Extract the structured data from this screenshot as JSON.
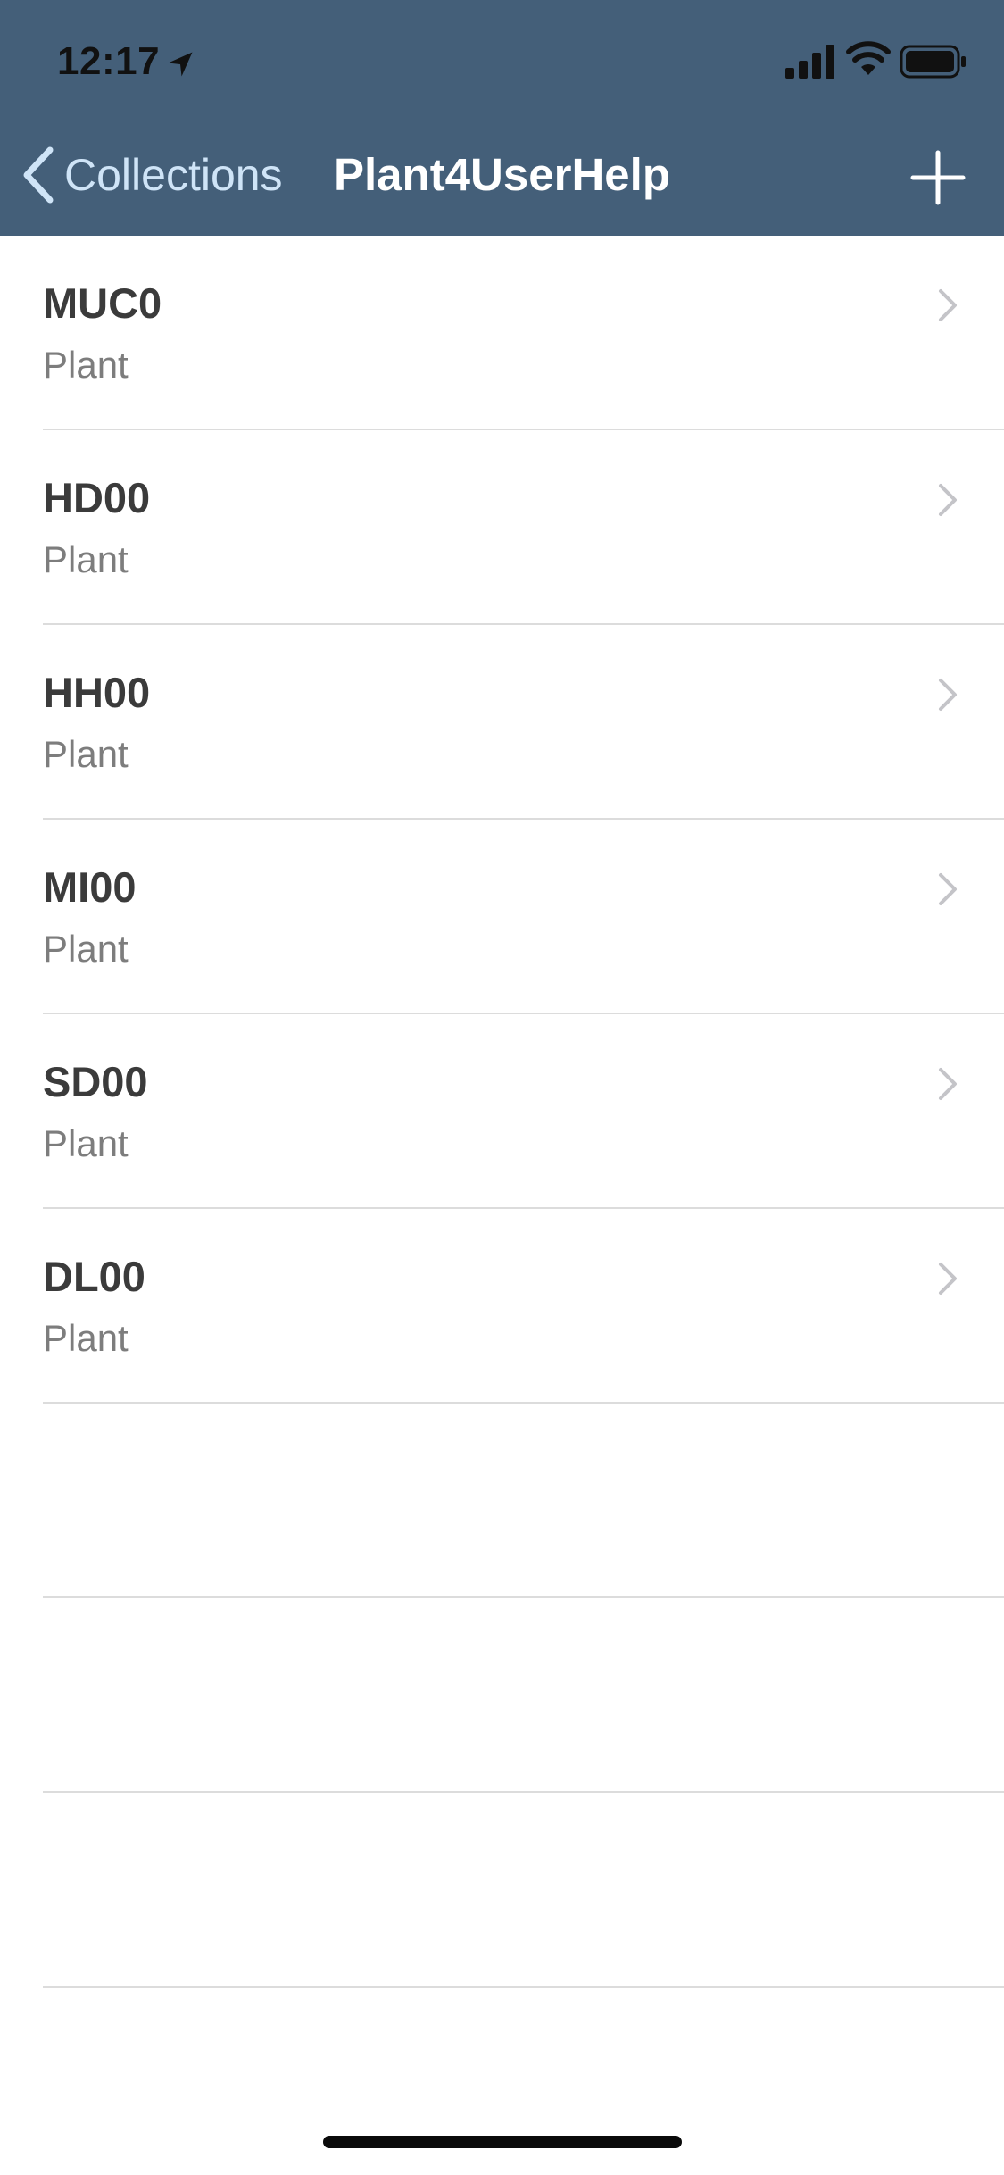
{
  "status_bar": {
    "time": "12:17"
  },
  "nav": {
    "back_label": "Collections",
    "title": "Plant4UserHelp"
  },
  "colors": {
    "nav_background": "#445f79",
    "back_tint": "#cfe4f7",
    "row_title": "#3b3b3b",
    "row_subtitle": "#7d7d7d",
    "separator": "#dcdcdc"
  },
  "icons": {
    "location": "location-arrow-icon",
    "signal": "cellular-signal-icon",
    "wifi": "wifi-icon",
    "battery": "battery-icon",
    "back": "chevron-left-icon",
    "add": "plus-icon",
    "disclosure": "chevron-right-icon"
  },
  "items": [
    {
      "title": "MUC0",
      "subtitle": "Plant"
    },
    {
      "title": "HD00",
      "subtitle": "Plant"
    },
    {
      "title": "HH00",
      "subtitle": "Plant"
    },
    {
      "title": "MI00",
      "subtitle": "Plant"
    },
    {
      "title": "SD00",
      "subtitle": "Plant"
    },
    {
      "title": "DL00",
      "subtitle": "Plant"
    }
  ]
}
